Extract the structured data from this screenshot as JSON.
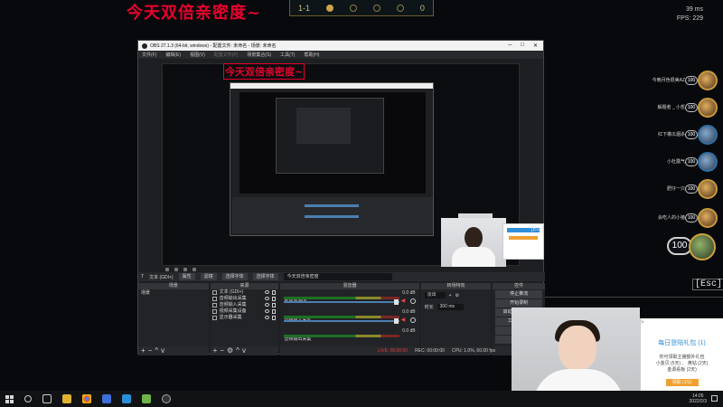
{
  "stream": {
    "title": "今天双倍亲密度~",
    "perf_ping": "39 ms",
    "perf_fps": "FPS: 229"
  },
  "game_hud": {
    "score": "1-1",
    "right_value": "0"
  },
  "champions": [
    {
      "name": "今晚月色很美AZ",
      "hp": "100",
      "style": "gold"
    },
    {
      "name": "解题者 _ 小哲",
      "hp": "100",
      "style": "gold"
    },
    {
      "name": "红下樽瓜烟杀",
      "hp": "100",
      "style": "blue"
    },
    {
      "name": "小杜露气",
      "hp": "100",
      "style": "blue"
    },
    {
      "name": "肥仔一只",
      "hp": "100",
      "style": "gold"
    },
    {
      "name": "会吃人的小猪",
      "hp": "100",
      "style": "gold"
    }
  ],
  "player": {
    "hp": "100"
  },
  "esc_label": "[Esc]",
  "obs": {
    "window_title": "OBS 27.1.3 (64-bit, windows) - 配置文件: 未命名 - 场景: 未命名",
    "menu": [
      {
        "label": "文件(F)",
        "disabled": false
      },
      {
        "label": "编辑(E)",
        "disabled": false
      },
      {
        "label": "视图(V)",
        "disabled": false
      },
      {
        "label": "配置文件(P)",
        "disabled": true
      },
      {
        "label": "场景集合(S)",
        "disabled": false
      },
      {
        "label": "工具(T)",
        "disabled": false
      },
      {
        "label": "帮助(H)",
        "disabled": false
      }
    ],
    "props_bar": {
      "source_name": "文本 (GDI+)",
      "properties_label": "属性",
      "filters_label": "滤镜",
      "select_label": "选择字体",
      "text_label": "选择字体",
      "text_value": "今天双倍亲密度"
    },
    "docks": {
      "scenes_title": "场景",
      "scenes": [
        "场景"
      ],
      "sources_title": "来源",
      "sources": [
        "文本 (GDI+)",
        "音频输出采集",
        "音频输入采集",
        "视频采集设备",
        "显示器采集"
      ],
      "mixer_title": "混音器",
      "mixer": [
        {
          "name": "麦克风/Aux",
          "db": "0.0 dB"
        },
        {
          "name": "音频输入采集",
          "db": "0.0 dB"
        },
        {
          "name": "音频输出采集",
          "db": "0.0 dB"
        }
      ],
      "transitions_title": "转场特效",
      "transition_type": "淡出",
      "duration_label": "时长",
      "duration_value": "300 ms",
      "controls_title": "控件",
      "controls": [
        "停止推流",
        "开始录制",
        "启动虚拟摄像机",
        "工作室模式",
        "设置",
        "退出"
      ]
    },
    "status": {
      "live": "LIVE: 00:00:00",
      "rec": "REC: 00:00:00",
      "cpu": "CPU: 1.0%, 60.00 fps"
    }
  },
  "popup": {
    "close": "×",
    "title": "每日登陆礼包 (1)",
    "text_line1": "你可领取主播额外礼包",
    "text_line2": "小金贝 (5天) 、 黄钻 (2天)",
    "text_line3": "金源看板 (2天)",
    "button": "领取 (1/1)"
  },
  "taskbar": {
    "time": "14:05",
    "date": "2022/2/3",
    "ime": "中"
  }
}
